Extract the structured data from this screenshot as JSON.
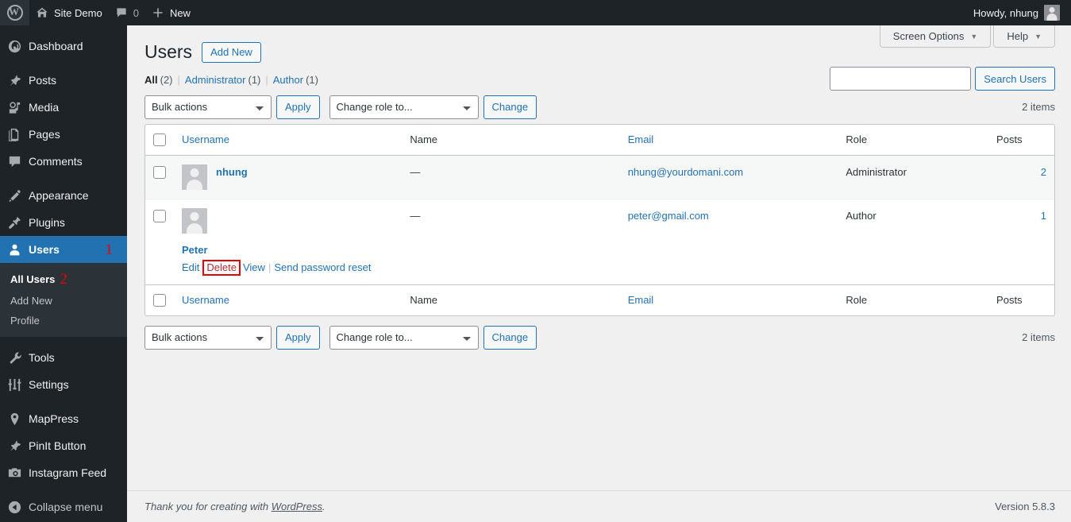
{
  "adminbar": {
    "wp_logo": "wordpress-logo-icon",
    "site_name": "Site Demo",
    "comments_count": "0",
    "new_label": "New",
    "howdy": "Howdy, nhung"
  },
  "sidebar": {
    "items": [
      {
        "label": "Dashboard",
        "icon": "dashboard-icon",
        "name": "dashboard"
      },
      {
        "sep": true
      },
      {
        "label": "Posts",
        "icon": "posts-pin-icon",
        "name": "posts"
      },
      {
        "label": "Media",
        "icon": "media-icon",
        "name": "media"
      },
      {
        "label": "Pages",
        "icon": "pages-icon",
        "name": "pages"
      },
      {
        "label": "Comments",
        "icon": "comments-bubble-icon",
        "name": "comments"
      },
      {
        "sep": true
      },
      {
        "label": "Appearance",
        "icon": "appearance-brush-icon",
        "name": "appearance"
      },
      {
        "label": "Plugins",
        "icon": "plugins-plug-icon",
        "name": "plugins"
      },
      {
        "label": "Users",
        "icon": "users-person-icon",
        "name": "users",
        "current": true,
        "marker": "1"
      }
    ],
    "submenu": [
      {
        "label": "All Users",
        "current": true,
        "marker": "2"
      },
      {
        "label": "Add New"
      },
      {
        "label": "Profile"
      }
    ],
    "items_after": [
      {
        "label": "Tools",
        "icon": "tools-wrench-icon",
        "name": "tools"
      },
      {
        "label": "Settings",
        "icon": "settings-sliders-icon",
        "name": "settings"
      },
      {
        "sep": true
      },
      {
        "label": "MapPress",
        "icon": "map-pin-icon",
        "name": "mappress"
      },
      {
        "label": "PinIt Button",
        "icon": "pin-icon",
        "name": "pinit-button"
      },
      {
        "label": "Instagram Feed",
        "icon": "camera-icon",
        "name": "instagram-feed"
      }
    ],
    "collapse": {
      "label": "Collapse menu",
      "icon": "collapse-arrow-icon"
    }
  },
  "screen_meta": {
    "screen_options": "Screen Options",
    "help": "Help",
    "caret": "▼"
  },
  "page": {
    "title": "Users",
    "add_new": "Add New"
  },
  "filters": [
    {
      "label": "All",
      "count": "(2)",
      "current": true
    },
    {
      "label": "Administrator",
      "count": "(1)",
      "current": false
    },
    {
      "label": "Author",
      "count": "(1)",
      "current": false
    }
  ],
  "search": {
    "value": "",
    "placeholder": "",
    "button": "Search Users"
  },
  "tablenav_top": {
    "bulk_actions": "Bulk actions",
    "apply": "Apply",
    "change_role": "Change role to...",
    "change": "Change",
    "displaying_num": "2 items"
  },
  "tablenav_bottom": {
    "bulk_actions": "Bulk actions",
    "apply": "Apply",
    "change_role": "Change role to...",
    "change": "Change",
    "displaying_num": "2 items"
  },
  "table": {
    "columns": [
      "Username",
      "Name",
      "Email",
      "Role",
      "Posts"
    ],
    "rows": [
      {
        "username": "nhung",
        "name": "—",
        "email": "nhung@yourdomani.com",
        "role": "Administrator",
        "posts": "2",
        "actions": []
      },
      {
        "username": "Peter",
        "name": "—",
        "email": "peter@gmail.com",
        "role": "Author",
        "posts": "1",
        "actions": [
          {
            "label": "Edit",
            "highlighted": false
          },
          {
            "label": "Delete",
            "highlighted": true
          },
          {
            "label": "View",
            "highlighted": false
          },
          {
            "label": "Send password reset",
            "highlighted": false
          }
        ]
      }
    ]
  },
  "footer": {
    "thanks_prefix": "Thank you for creating with ",
    "wordpress_link": "WordPress",
    "thanks_suffix": ".",
    "version": "Version 5.8.3"
  },
  "colors": {
    "admin_dark": "#1d2327",
    "admin_submenu": "#2c3338",
    "accent_blue": "#2271b1",
    "link_blue": "#2271b1",
    "page_bg": "#f0f0f1",
    "marker_red": "#e60000",
    "delete_red": "#b32d2e"
  }
}
